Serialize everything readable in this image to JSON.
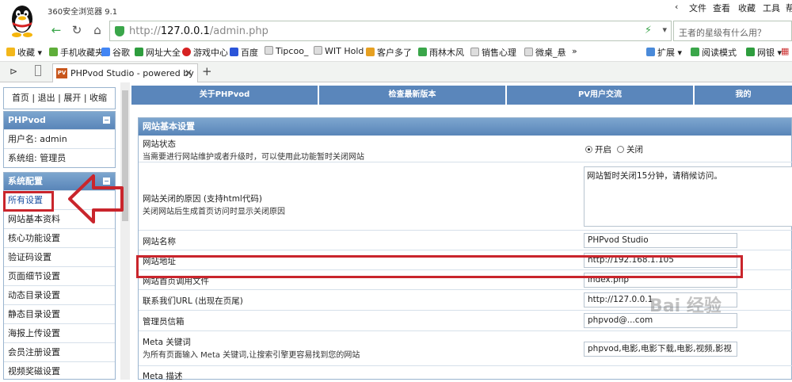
{
  "browser": {
    "title": "360安全浏览器 9.1",
    "menu": [
      "文件",
      "查看",
      "收藏",
      "工具",
      "帮"
    ],
    "url_host": "127.0.0.1",
    "url_path": "/admin.php",
    "url_prefix": "http://",
    "search_placeholder": "王者的星级有什么用？",
    "bookmarks": [
      "收藏",
      "手机收藏夹",
      "谷歌",
      "网址大全",
      "游戏中心",
      "百度",
      "Tipcoo_",
      "WIT Hold",
      "客户多了",
      "雨林木风",
      "销售心理",
      "微桌_悬"
    ],
    "bookmarks_more": "»",
    "right_bookmarks": [
      "扩展",
      "阅读模式",
      "网银"
    ],
    "tab_title": "PHPvod Studio - powered by",
    "tab_icon_text": "PV",
    "new_tab": "+"
  },
  "sidebar": {
    "top_links": "首页 | 退出 | 展开 | 收缩",
    "user_panel": {
      "title": "PHPvod",
      "username": "用户名: admin",
      "group": "系统组: 管理员"
    },
    "config_panel": {
      "title": "系统配置",
      "items": [
        "所有设置",
        "网站基本资料",
        "核心功能设置",
        "验证码设置",
        "页面细节设置",
        "动态目录设置",
        "静态目录设置",
        "海报上传设置",
        "会员注册设置",
        "视频奖磁设置"
      ]
    }
  },
  "topnav": [
    "关于PHPvod",
    "检查最新版本",
    "PV用户交流",
    "我的"
  ],
  "settings": {
    "title": "网站基本设置",
    "site_status": {
      "label": "网站状态",
      "hint": "当需要进行网站维护或者升级时，可以使用此功能暂时关闭网站",
      "on": "开启",
      "off": "关闭",
      "selected": "开启"
    },
    "close_reason": {
      "label": "网站关闭的原因 (支持html代码)",
      "hint": "关闭网站后生成首页访问时显示关闭原因",
      "value": "网站暂时关闭15分钟，请稍候访问。"
    },
    "site_name": {
      "label": "网站名称",
      "value": "PHPvod Studio"
    },
    "site_url": {
      "label": "网站地址",
      "value": "http://192.168.1.105"
    },
    "index_file": {
      "label": "网站首页调用文件",
      "value": "index.php"
    },
    "contact_url": {
      "label": "联系我们URL (出现在页尾)",
      "value": "http://127.0.0.1"
    },
    "admin_email": {
      "label": "管理员信箱",
      "value": "phpvod@...com"
    },
    "meta_keywords": {
      "label": "Meta 关键词",
      "hint": "为所有页面输入 Meta 关键词,让搜索引擎更容易找到您的网站",
      "value": "phpvod,电影,电影下载,电影,视频,影视"
    },
    "meta_desc": {
      "label": "Meta 描述"
    }
  },
  "watermark": "Bai 经验",
  "colors": {
    "accent": "#5a86bb",
    "highlight": "#c9252c"
  }
}
